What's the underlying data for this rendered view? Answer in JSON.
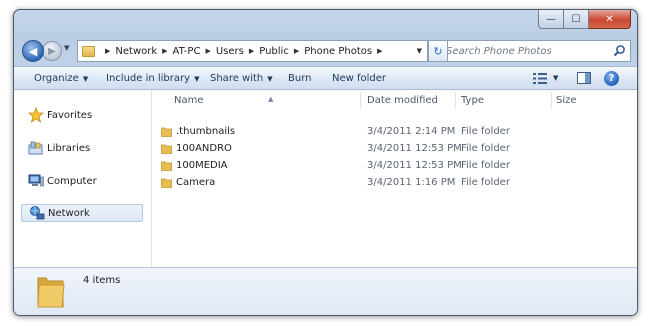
{
  "window": {
    "caption_buttons": {
      "minimize": "—",
      "maximize": "☐",
      "close": "✕"
    }
  },
  "nav": {
    "back_glyph": "◀",
    "forward_glyph": "▶",
    "recent_dropdown_glyph": "▼"
  },
  "address_bar": {
    "breadcrumbs": [
      "Network",
      "AT-PC",
      "Users",
      "Public",
      "Phone Photos"
    ],
    "separator": "▶",
    "dropdown_glyph": "▼",
    "refresh_glyph": "↻"
  },
  "search": {
    "placeholder": "Search Phone Photos"
  },
  "toolbar": {
    "organize": "Organize",
    "include_in_library": "Include in library",
    "share_with": "Share with",
    "burn": "Burn",
    "new_folder": "New folder",
    "dropdown_glyph": "▼",
    "help": "?"
  },
  "sidebar": {
    "items": [
      {
        "label": "Favorites",
        "icon": "star-icon"
      },
      {
        "label": "Libraries",
        "icon": "libraries-icon"
      },
      {
        "label": "Computer",
        "icon": "computer-icon"
      },
      {
        "label": "Network",
        "icon": "network-icon",
        "selected": true
      }
    ]
  },
  "file_list": {
    "columns": {
      "name": "Name",
      "date_modified": "Date modified",
      "type": "Type",
      "size": "Size"
    },
    "sort_glyph": "▲",
    "rows": [
      {
        "name": ".thumbnails",
        "date_modified": "3/4/2011 2:14 PM",
        "type": "File folder",
        "size": ""
      },
      {
        "name": "100ANDRO",
        "date_modified": "3/4/2011 12:53 PM",
        "type": "File folder",
        "size": ""
      },
      {
        "name": "100MEDIA",
        "date_modified": "3/4/2011 12:53 PM",
        "type": "File folder",
        "size": ""
      },
      {
        "name": "Camera",
        "date_modified": "3/4/2011 1:16 PM",
        "type": "File folder",
        "size": ""
      }
    ]
  },
  "details_pane": {
    "item_count": "4 items"
  },
  "colors": {
    "chrome": "#c3d4ea",
    "selection": "#dce7f4",
    "folder": "#e9bd52",
    "close_button": "#c9472f"
  }
}
